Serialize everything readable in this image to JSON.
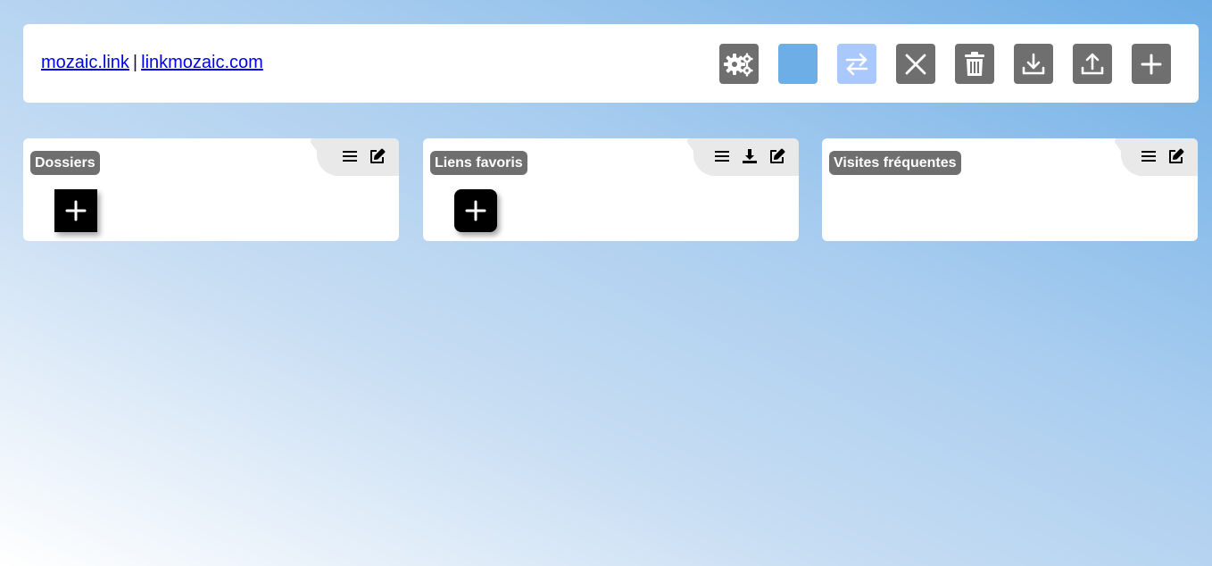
{
  "header": {
    "link1": "mozaic.link",
    "separator": "|",
    "link2": "linkmozaic.com"
  },
  "toolbar": {
    "buttons": [
      {
        "name": "settings-button",
        "icon": "gears-icon",
        "color": "#6f6f6f"
      },
      {
        "name": "color-button",
        "icon": "color-swatch",
        "color": "#6eaee6"
      },
      {
        "name": "swap-button",
        "icon": "swap-arrows-icon",
        "color": "#a9c8fb"
      },
      {
        "name": "close-button",
        "icon": "close-icon",
        "color": "#6f6f6f"
      },
      {
        "name": "delete-button",
        "icon": "trash-icon",
        "color": "#6f6f6f"
      },
      {
        "name": "download-button",
        "icon": "download-icon",
        "color": "#6f6f6f"
      },
      {
        "name": "upload-button",
        "icon": "upload-icon",
        "color": "#6f6f6f"
      },
      {
        "name": "add-button",
        "icon": "plus-icon",
        "color": "#6f6f6f"
      }
    ]
  },
  "widgets": [
    {
      "title": "Dossiers",
      "icons": [
        "menu-icon",
        "edit-icon"
      ],
      "has_add_tile": true
    },
    {
      "title": "Liens favoris",
      "icons": [
        "menu-icon",
        "download-icon",
        "edit-icon"
      ],
      "has_add_tile": true
    },
    {
      "title": "Visites fréquentes",
      "icons": [
        "menu-icon",
        "edit-icon"
      ],
      "has_add_tile": false
    }
  ],
  "colors": {
    "button_gray": "#6f6f6f",
    "accent_blue": "#6eaee6",
    "swap_blue": "#a9c8fb",
    "link": "#0000ee",
    "tab_gray": "#e9e9e9"
  }
}
